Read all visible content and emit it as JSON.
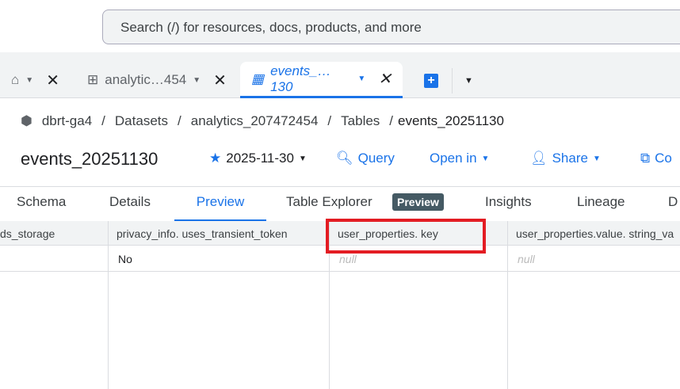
{
  "search": {
    "placeholder": "Search (/) for resources, docs, products, and more"
  },
  "tabs": [
    {
      "label": "analytic…454"
    },
    {
      "label": "events_… 130"
    }
  ],
  "breadcrumb": [
    "dbrt-ga4",
    "Datasets",
    "analytics_207472454",
    "Tables",
    "events_20251130"
  ],
  "title": "events_20251130",
  "actions": {
    "date": "2025-11-30",
    "query": "Query",
    "open_in": "Open in",
    "share": "Share",
    "copy": "Co"
  },
  "nav_tabs": [
    "Schema",
    "Details",
    "Preview",
    "Table Explorer",
    "Insights",
    "Lineage",
    "D"
  ],
  "nav_badge": "Preview",
  "columns": [
    "ds_storage",
    "privacy_info. uses_transient_token",
    "user_properties. key",
    "user_properties.value. string_va"
  ],
  "row": [
    "",
    "No",
    "null",
    "null"
  ],
  "colors": {
    "accent": "#1a73e8",
    "highlight": "#e31c23"
  }
}
